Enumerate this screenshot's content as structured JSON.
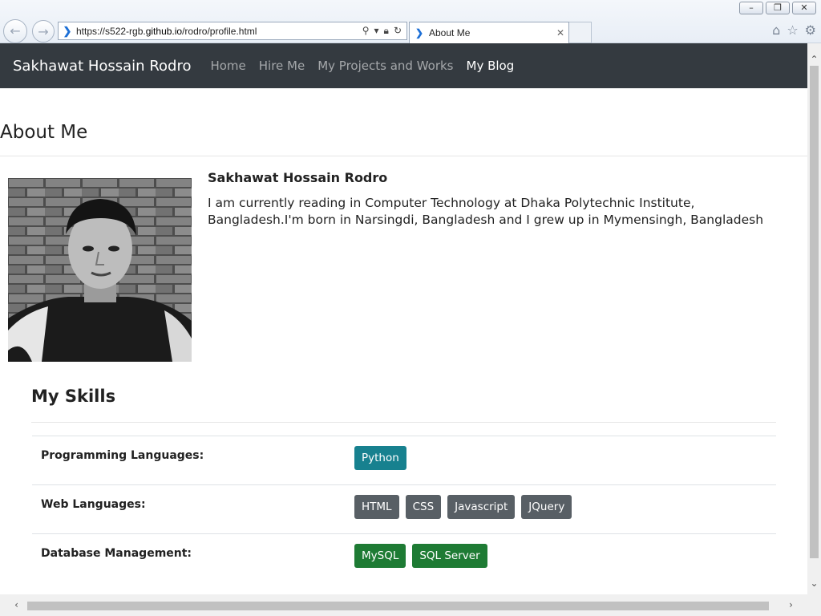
{
  "browser": {
    "url_prefix": "https://s522-rgb.",
    "url_domain": "github.io",
    "url_path": "/rodro/profile.html",
    "tab_title": "About Me"
  },
  "navbar": {
    "brand": "Sakhawat Hossain Rodro",
    "links": [
      {
        "label": "Home",
        "active": false
      },
      {
        "label": "Hire Me",
        "active": false
      },
      {
        "label": "My Projects and Works",
        "active": false
      },
      {
        "label": "My Blog",
        "active": true
      }
    ]
  },
  "about": {
    "title": "About Me",
    "name": "Sakhawat Hossain Rodro",
    "bio": "I am currently reading in Computer Technology at Dhaka Polytechnic Institute, Bangladesh.I'm born in Narsingdi, Bangladesh and I grew up in Mymensingh, Bangladesh"
  },
  "skills": {
    "title": "My Skills",
    "rows": [
      {
        "label": "Programming Languages:",
        "badges": [
          {
            "text": "Python",
            "variant": "info"
          }
        ]
      },
      {
        "label": "Web Languages:",
        "badges": [
          {
            "text": "HTML",
            "variant": "secondary"
          },
          {
            "text": "CSS",
            "variant": "secondary"
          },
          {
            "text": "Javascript",
            "variant": "secondary"
          },
          {
            "text": "JQuery",
            "variant": "secondary"
          }
        ]
      },
      {
        "label": "Database Management:",
        "badges": [
          {
            "text": "MySQL",
            "variant": "success"
          },
          {
            "text": "SQL Server",
            "variant": "success"
          }
        ]
      }
    ]
  },
  "colors": {
    "navbar_bg": "#343a40",
    "badge_info": "#17818f",
    "badge_secondary": "#585f65",
    "badge_success": "#1e7b34"
  }
}
